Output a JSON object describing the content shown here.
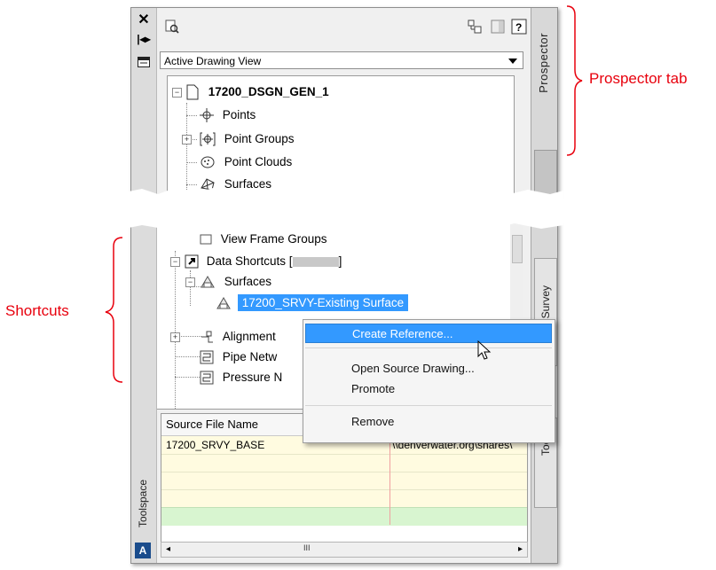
{
  "top_panel": {
    "dropdown_value": "Active Drawing View",
    "right_tab_label": "Prospector",
    "tree": {
      "root": "17200_DSGN_GEN_1",
      "items": [
        "Points",
        "Point Groups",
        "Point Clouds",
        "Surfaces"
      ]
    }
  },
  "bottom_panel": {
    "tree": {
      "view_frame_groups": "View Frame Groups",
      "data_shortcuts": "Data Shortcuts [",
      "data_shortcuts_close": "]",
      "surfaces": "Surfaces",
      "selected_item": "17200_SRVY-Existing Surface",
      "alignments": "Alignment",
      "pipe_networks": "Pipe Netw",
      "pressure_networks": "Pressure N"
    },
    "grid": {
      "header": "Source File Name",
      "row1_col1": "17200_SRVY_BASE",
      "row1_col2": "\\\\denverwater.org\\shares\\"
    },
    "left_tab_label": "Toolspace",
    "right_tab_survey": "Survey",
    "right_tab_tool": "Tool",
    "hscroll_mark": "III"
  },
  "context_menu": {
    "create_reference": "Create Reference...",
    "open_source": "Open Source Drawing...",
    "promote": "Promote",
    "remove": "Remove"
  },
  "annotations": {
    "prospector_tab": "Prospector tab",
    "shortcuts": "Shortcuts"
  },
  "colors": {
    "annotation": "#e8000d",
    "selection": "#3399ff",
    "grid_row_yellow": "#fffbe0",
    "grid_row_green": "#d8f5d0"
  }
}
